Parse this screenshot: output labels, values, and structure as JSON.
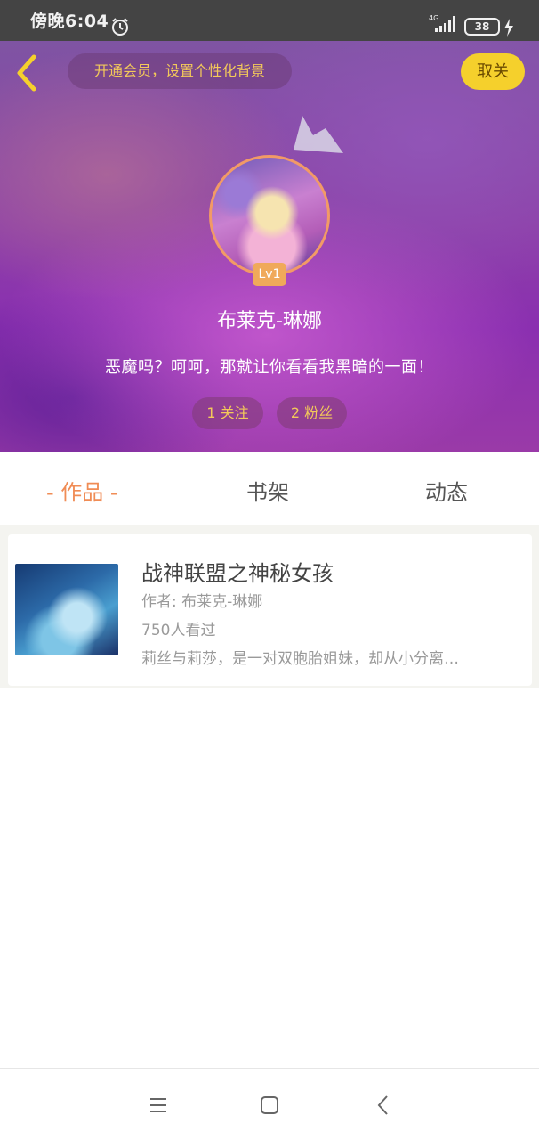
{
  "status_bar": {
    "time": "傍晚6:04",
    "network": "4G",
    "battery": "38"
  },
  "header": {
    "vip_prompt": "开通会员，设置个性化背景",
    "follow_button": "取关",
    "level": "Lv1",
    "username": "布莱克-琳娜",
    "bio": "恶魔吗？呵呵，那就让你看看我黑暗的一面！",
    "stats": {
      "following": "1 关注",
      "fans": "2 粉丝"
    }
  },
  "tabs": [
    {
      "label": "- 作品 -",
      "active": true
    },
    {
      "label": "书架",
      "active": false
    },
    {
      "label": "动态",
      "active": false
    }
  ],
  "works": [
    {
      "title": "战神联盟之神秘女孩",
      "author": "作者: 布莱克-琳娜",
      "views": "750人看过",
      "description": "莉丝与莉莎，是一对双胞胎姐妹，却从小分离…"
    }
  ],
  "colors": {
    "accent_orange": "#f08c55",
    "gold": "#f3c95a",
    "follow_yellow": "#f5d02c",
    "header_purple": "#8a2fb0"
  },
  "icons": {
    "back": "chevron-left-icon",
    "alarm": "alarm-clock-icon",
    "crown": "crown-icon",
    "nav_menu": "menu-icon",
    "nav_home": "home-square-icon",
    "nav_back": "back-triangle-icon"
  }
}
